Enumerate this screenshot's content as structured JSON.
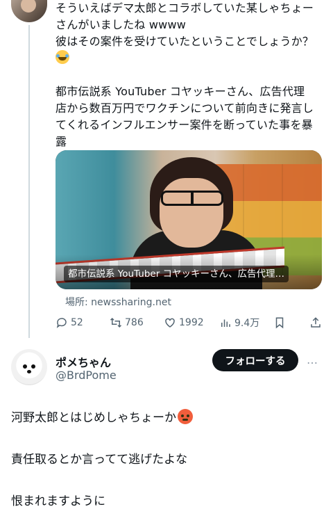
{
  "tweet": {
    "text_lines": [
      "そういえばデマ太郎とコラボしていた某しゃちょー",
      "さんがいましたね wwww",
      "彼はその案件を受けていたということでしょうか？"
    ],
    "paragraph2_lines": [
      "都市伝説系 YouTuber コヤッキーさん、広告代理",
      "店から数百万円でワクチンについて前向きに発言し",
      "てくれるインフルエンサー案件を断っていた事を暴",
      "露"
    ],
    "card_title": "都市伝説系 YouTuber コヤッキーさん、広告代理…",
    "source": "場所: newssharing.net",
    "stats": {
      "replies": "52",
      "retweets": "786",
      "likes": "1992",
      "views": "9.4万"
    },
    "emoji": "laughing-with-tears-emoji"
  },
  "reply": {
    "name": "ポメちゃん",
    "handle": "@BrdPome",
    "follow_label": "フォローする",
    "more_label": "…",
    "lines": [
      "河野太郎とはじめしゃちょーか",
      "責任取るとか言ってて逃げたよな",
      "恨まれますように"
    ],
    "emoji": "angry-face-emoji"
  },
  "colors": {
    "text": "#0f1419",
    "muted": "#536471",
    "follow_bg": "#0f1419",
    "thread_line": "#cfd9de"
  }
}
